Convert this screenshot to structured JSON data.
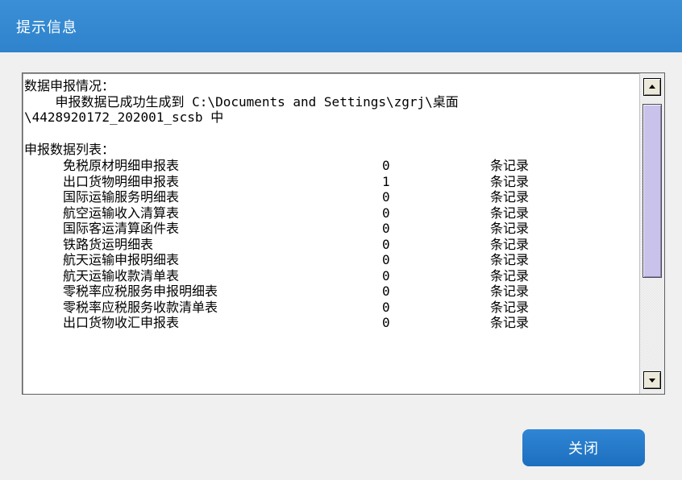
{
  "window": {
    "title": "提示信息"
  },
  "message": {
    "summary_heading": "数据申报情况：",
    "success_line_1": "    申报数据已成功生成到 C:\\Documents and Settings\\zgrj\\桌面",
    "success_line_2": "\\4428920172_202001_scsb 中",
    "list_heading": "申报数据列表：",
    "records": [
      {
        "name": "免税原材明细申报表",
        "count": "0",
        "unit": "条记录"
      },
      {
        "name": "出口货物明细申报表",
        "count": "1",
        "unit": "条记录"
      },
      {
        "name": "国际运输服务明细表",
        "count": "0",
        "unit": "条记录"
      },
      {
        "name": "航空运输收入清算表",
        "count": "0",
        "unit": "条记录"
      },
      {
        "name": "国际客运清算函件表",
        "count": "0",
        "unit": "条记录"
      },
      {
        "name": "铁路货运明细表",
        "count": "0",
        "unit": "条记录"
      },
      {
        "name": "航天运输申报明细表",
        "count": "0",
        "unit": "条记录"
      },
      {
        "name": "航天运输收款清单表",
        "count": "0",
        "unit": "条记录"
      },
      {
        "name": "零税率应税服务申报明细表",
        "count": "0",
        "unit": "条记录"
      },
      {
        "name": "零税率应税服务收款清单表",
        "count": "0",
        "unit": "条记录"
      },
      {
        "name": "出口货物收汇申报表",
        "count": "0",
        "unit": "条记录"
      }
    ]
  },
  "buttons": {
    "close_label": "关闭"
  },
  "icons": {
    "scroll_up": "scroll-up-arrow-icon",
    "scroll_down": "scroll-down-arrow-icon"
  },
  "colors": {
    "titlebar": "#2f83cc",
    "button": "#1d6fbe",
    "scroll_thumb": "#c9c3ec"
  }
}
